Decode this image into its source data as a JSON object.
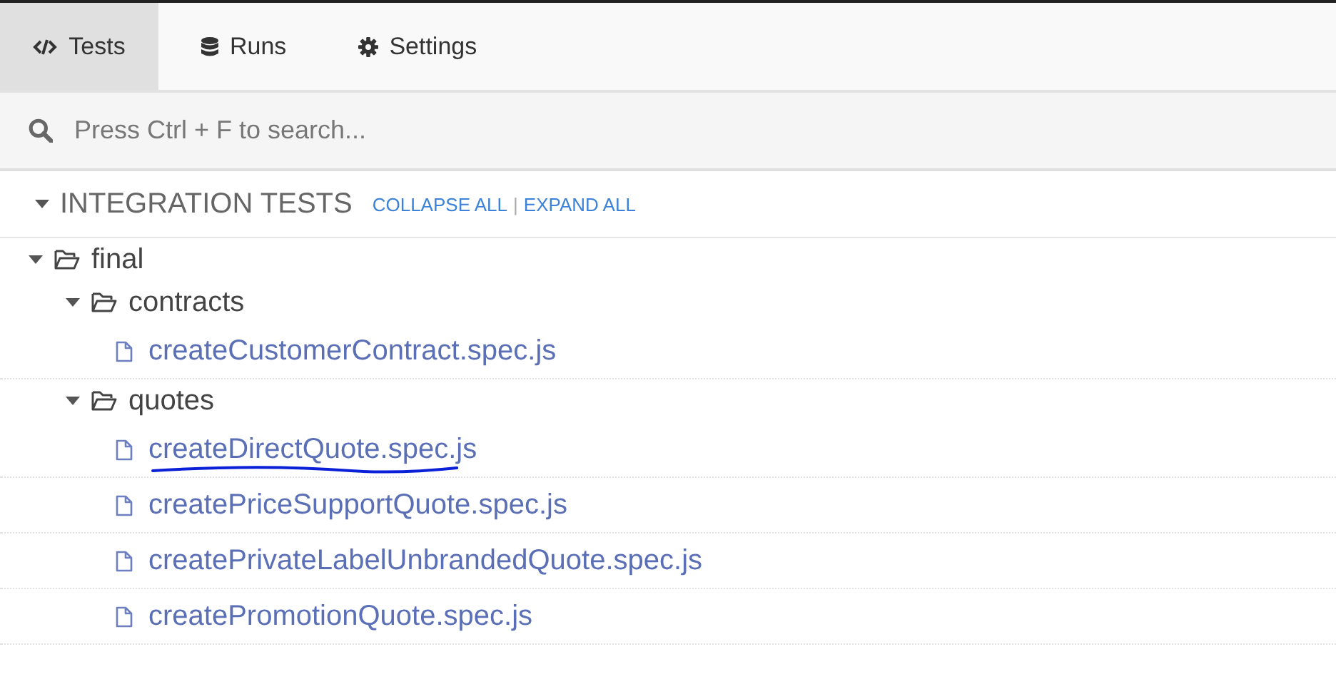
{
  "tabs": [
    {
      "label": "Tests",
      "selected": true
    },
    {
      "label": "Runs",
      "selected": false
    },
    {
      "label": "Settings",
      "selected": false
    }
  ],
  "search": {
    "placeholder": "Press Ctrl + F to search..."
  },
  "section": {
    "title": "INTEGRATION TESTS",
    "expanded": true,
    "collapse_all": "COLLAPSE ALL",
    "separator": "|",
    "expand_all": "EXPAND ALL"
  },
  "tree": [
    {
      "kind": "folder",
      "name": "final",
      "expanded": true,
      "children": [
        {
          "kind": "folder",
          "name": "contracts",
          "expanded": true,
          "children": [
            {
              "kind": "file",
              "name": "createCustomerContract.spec.js",
              "underlined": false
            }
          ]
        },
        {
          "kind": "folder",
          "name": "quotes",
          "expanded": true,
          "children": [
            {
              "kind": "file",
              "name": "createDirectQuote.spec.js",
              "underlined": true
            },
            {
              "kind": "file",
              "name": "createPriceSupportQuote.spec.js",
              "underlined": false
            },
            {
              "kind": "file",
              "name": "createPrivateLabelUnbrandedQuote.spec.js",
              "underlined": false
            },
            {
              "kind": "file",
              "name": "createPromotionQuote.spec.js",
              "underlined": false
            }
          ]
        }
      ]
    }
  ]
}
